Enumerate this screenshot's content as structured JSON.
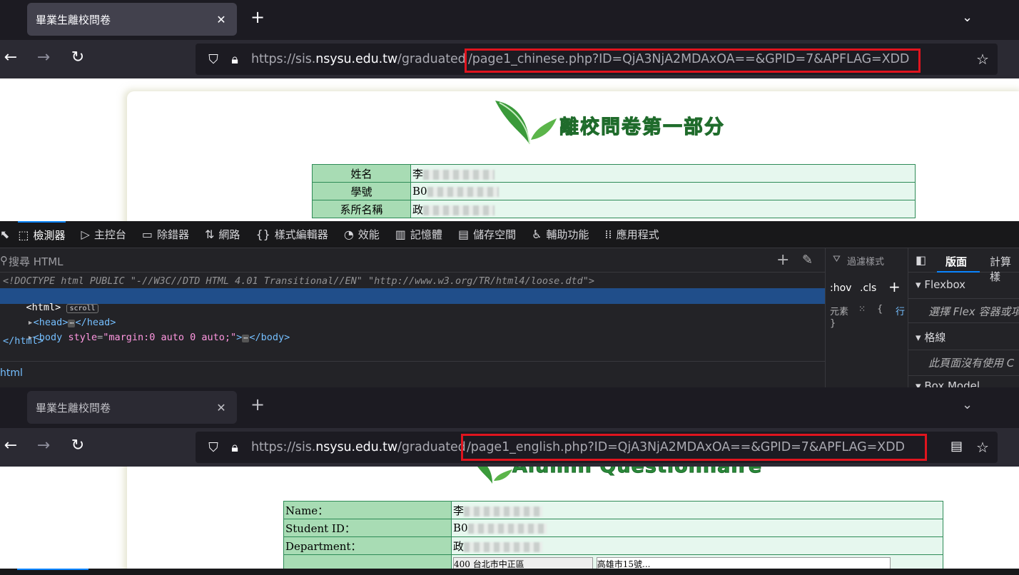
{
  "top_browser": {
    "tab_title": "畢業生離校問卷",
    "url_prefix": "https://sis.",
    "url_host": "nsysu.edu.tw",
    "url_path": "/graduated",
    "url_highlight": "/page1_chinese.php?ID=QjA3NjA2MDAxOA==&GPID=7&APFLAG=XDD"
  },
  "top_page": {
    "heading": "離校問卷第一部分",
    "rows": [
      {
        "label": "姓名",
        "value": "李"
      },
      {
        "label": "學號",
        "value": "B0"
      },
      {
        "label": "系所名稱",
        "value": "政"
      }
    ]
  },
  "devtools": {
    "tabs": [
      {
        "icon": "⬚",
        "label": "檢測器"
      },
      {
        "icon": "▷",
        "label": "主控台"
      },
      {
        "icon": "▭",
        "label": "除錯器"
      },
      {
        "icon": "⇅",
        "label": "網路"
      },
      {
        "icon": "{}",
        "label": "樣式編輯器"
      },
      {
        "icon": "◔",
        "label": "效能"
      },
      {
        "icon": "▥",
        "label": "記憶體"
      },
      {
        "icon": "▤",
        "label": "儲存空間"
      },
      {
        "icon": "♿",
        "label": "輔助功能"
      },
      {
        "icon": "⁞⁞",
        "label": "應用程式"
      }
    ],
    "search_placeholder": "搜尋 HTML",
    "doctype": "<!DOCTYPE html PUBLIC \"-//W3C//DTD HTML 4.01 Transitional//EN\" \"http://www.w3.org/TR/html4/loose.dtd\">",
    "html_open": "<html>",
    "scroll_badge": "scroll",
    "head_open": "<head>",
    "head_close": "</head>",
    "body_open": "<body",
    "body_attr": "style",
    "body_attr_value": "\"margin:0 auto 0 auto;\"",
    "body_close": "</body>",
    "html_close": "</html>",
    "breadcrumb": "html",
    "filter_label": "過濾樣式",
    "hov": ":hov",
    "cls": ".cls",
    "rule_selector": "元素",
    "rule_brace_open": "{",
    "rule_brace_close": "}",
    "inline_label": "行",
    "layout_tab": "版面",
    "computed_tab": "計算樣",
    "flexbox_title": "Flexbox",
    "flexbox_hint": "選擇 Flex 容器或項",
    "grid_title": "格線",
    "grid_hint": "此頁面沒有使用 C",
    "boxmodel_title": "Box Model"
  },
  "bottom_browser": {
    "tab_title": "畢業生離校問卷",
    "url_prefix": "https://sis.",
    "url_host": "nsysu.edu.tw",
    "url_path": "/graduated",
    "url_highlight": "/page1_english.php?ID=QjA3NjA2MDAxOA==&GPID=7&APFLAG=XDD"
  },
  "bottom_page": {
    "heading": "Alumni Questionnaire",
    "rows": [
      {
        "label": "Name：",
        "value": "李"
      },
      {
        "label": "Student ID：",
        "value": "B0"
      },
      {
        "label": "Department：",
        "value": "政"
      }
    ],
    "partial_select": "400 台北市中正區",
    "partial_address": "高雄市15號..."
  },
  "colors": {
    "highlight": "#e0141e",
    "table_label_bg": "#a8dcb4",
    "table_value_bg": "#e6f7ee"
  }
}
